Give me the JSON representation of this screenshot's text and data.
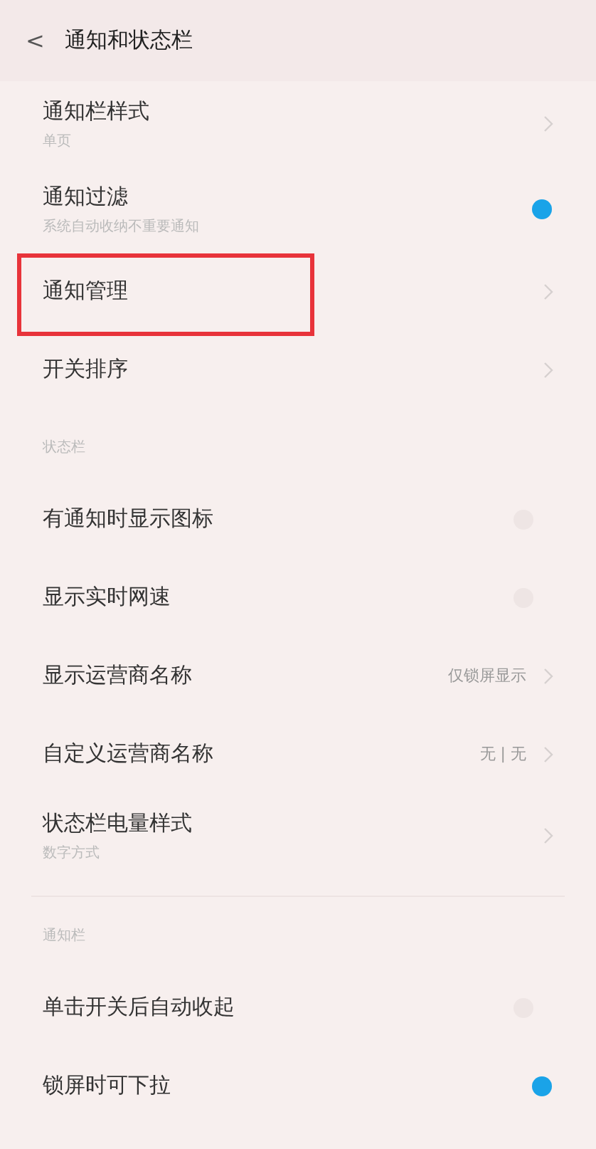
{
  "header": {
    "back": "<",
    "title": "通知和状态栏"
  },
  "sections": [
    {
      "items": [
        {
          "kind": "nav",
          "title": "通知栏样式",
          "subtitle": "单页",
          "highlighted": false
        },
        {
          "kind": "switch",
          "title": "通知过滤",
          "subtitle": "系统自动收纳不重要通知",
          "on": true
        },
        {
          "kind": "nav",
          "title": "通知管理",
          "highlighted": true
        },
        {
          "kind": "nav",
          "title": "开关排序",
          "highlighted": false
        }
      ]
    },
    {
      "label": "状态栏",
      "items": [
        {
          "kind": "switch",
          "title": "有通知时显示图标",
          "on": false
        },
        {
          "kind": "switch",
          "title": "显示实时网速",
          "on": false
        },
        {
          "kind": "nav",
          "title": "显示运营商名称",
          "value": "仅锁屏显示",
          "highlighted": false
        },
        {
          "kind": "nav",
          "title": "自定义运营商名称",
          "value": "无 | 无",
          "highlighted": false
        },
        {
          "kind": "nav",
          "title": "状态栏电量样式",
          "subtitle": "数字方式",
          "highlighted": false
        }
      ]
    },
    {
      "label": "通知栏",
      "items": [
        {
          "kind": "switch",
          "title": "单击开关后自动收起",
          "on": false
        },
        {
          "kind": "switch",
          "title": "锁屏时可下拉",
          "on": true
        }
      ]
    }
  ]
}
